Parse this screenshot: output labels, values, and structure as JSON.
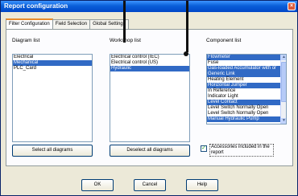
{
  "window": {
    "title": "Report configuration"
  },
  "tabs": [
    {
      "label": "Filter Configuration",
      "active": true
    },
    {
      "label": "Field Selection",
      "active": false
    },
    {
      "label": "Global Settings",
      "active": false
    }
  ],
  "diagram_list": {
    "label": "Diagram list",
    "items": [
      {
        "label": "Electrical",
        "selected": false
      },
      {
        "label": "Mechanical",
        "selected": true
      },
      {
        "label": "PLC_Card",
        "selected": false
      }
    ]
  },
  "workshop_list": {
    "label": "Workshop list",
    "items": [
      {
        "label": "Electrical control (IEC)",
        "selected": false
      },
      {
        "label": "Electrical control (US)",
        "selected": false
      },
      {
        "label": "Hydraulic",
        "selected": true
      }
    ]
  },
  "component_list": {
    "label": "Component list",
    "items": [
      {
        "label": "Flowmeter",
        "selected": true
      },
      {
        "label": "Fuse",
        "selected": false
      },
      {
        "label": "Gas-loaded Accumulator with or",
        "selected": true
      },
      {
        "label": "Generic Link",
        "selected": true
      },
      {
        "label": "Heating Element",
        "selected": false
      },
      {
        "label": "Horizontal Jumper",
        "selected": true
      },
      {
        "label": "In Reference",
        "selected": false
      },
      {
        "label": "Indicator Light",
        "selected": false
      },
      {
        "label": "Level Contact",
        "selected": true
      },
      {
        "label": "Level Switch Normally Open",
        "selected": false
      },
      {
        "label": "Level Switch Normally Open",
        "selected": false
      },
      {
        "label": "Manual Hydraulic Pump",
        "selected": true
      }
    ]
  },
  "buttons": {
    "select_all": "Select all diagrams",
    "deselect_all": "Deselect all diagrams",
    "ok": "OK",
    "cancel": "Cancel",
    "help": "Help"
  },
  "accessories_checkbox": {
    "label": "Accessories included in the report",
    "checked": true
  },
  "colors": {
    "titlebar": "#0a5fd8",
    "selection": "#316ac5",
    "dialog_bg": "#ece9d8"
  }
}
